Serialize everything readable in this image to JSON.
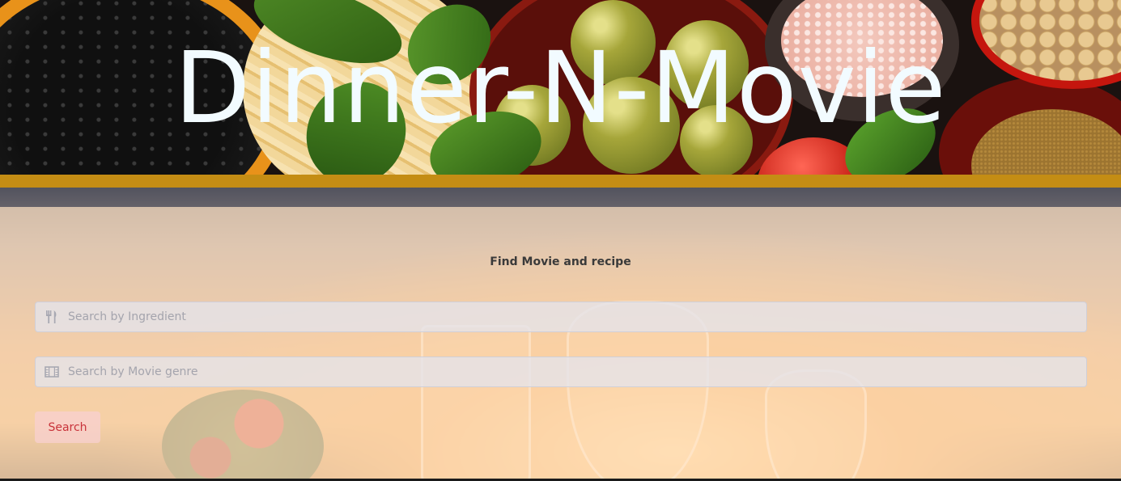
{
  "hero": {
    "title": "Dinner-N-Movie"
  },
  "search_panel": {
    "heading": "Find Movie and recipe",
    "ingredient_field": {
      "icon": "utensils-icon",
      "placeholder": "Search by Ingredient",
      "value": ""
    },
    "genre_field": {
      "icon": "film-icon",
      "placeholder": "Search by Movie genre",
      "value": ""
    },
    "search_button_label": "Search"
  },
  "colors": {
    "title_text": "#f2fbff",
    "gold_bar": "#c48d14",
    "panel_overlay": "#ffe2c4",
    "heading_text": "#3a3a3a",
    "input_background": "#e4e4ec",
    "placeholder_text": "#a4a4ad",
    "button_background": "#f8d0d0",
    "button_text": "#c8323a"
  }
}
